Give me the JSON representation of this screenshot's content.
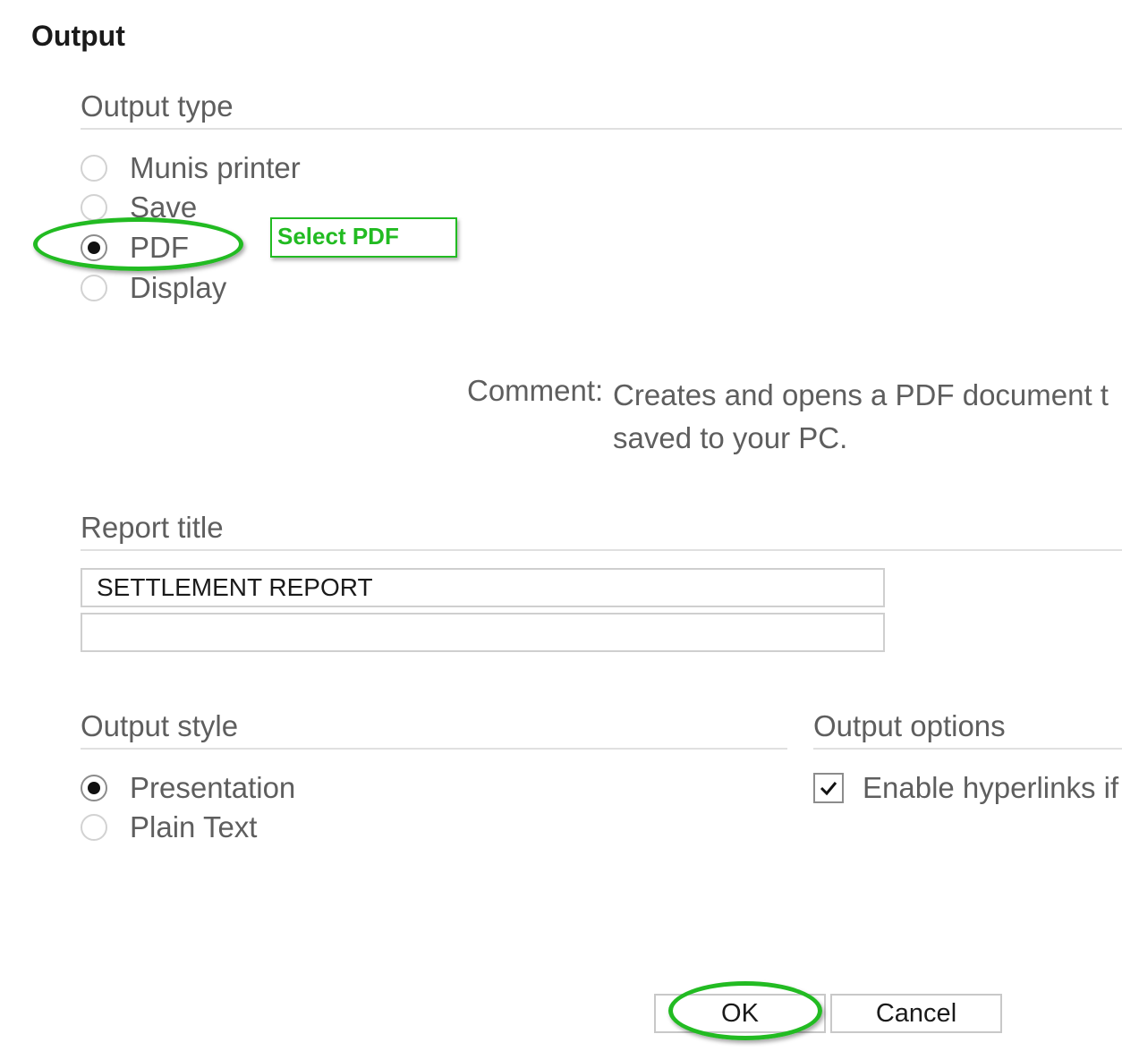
{
  "heading": "Output",
  "output_type": {
    "title": "Output type",
    "options": [
      {
        "label": "Munis printer",
        "selected": false
      },
      {
        "label": "Save",
        "selected": false
      },
      {
        "label": "PDF",
        "selected": true
      },
      {
        "label": "Display",
        "selected": false
      }
    ]
  },
  "annotation": {
    "callout": "Select PDF",
    "color": "#22bb22"
  },
  "comment": {
    "label": "Comment:",
    "line1": "Creates and opens a PDF document t",
    "line2": "saved to your PC."
  },
  "report_title": {
    "title": "Report title",
    "line1": "SETTLEMENT REPORT",
    "line2": ""
  },
  "output_style": {
    "title": "Output style",
    "options": [
      {
        "label": "Presentation",
        "selected": true
      },
      {
        "label": "Plain Text",
        "selected": false
      }
    ]
  },
  "output_options": {
    "title": "Output options",
    "enable_hyperlinks": {
      "label": "Enable hyperlinks if",
      "checked": true
    }
  },
  "buttons": {
    "ok": "OK",
    "cancel": "Cancel"
  }
}
